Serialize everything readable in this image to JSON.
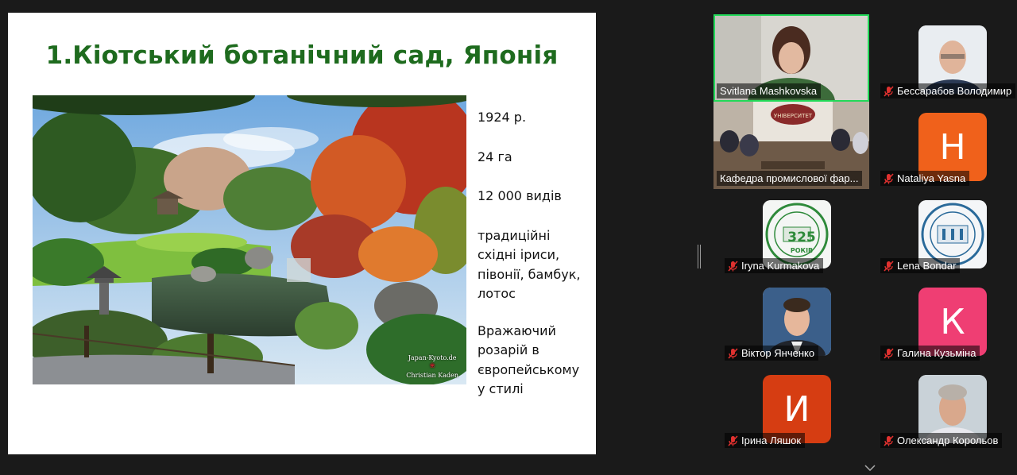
{
  "slide": {
    "title": "1.Кіотський ботанічний сад, Японія",
    "facts": {
      "year": "1924 р.",
      "area": "24 га",
      "species": "12 000 видів",
      "flowers": "традиційні східні іриси, півонії, бамбук, лотос",
      "rose_garden": "Вражаючий розарій в європейському у стилі"
    },
    "photo_credit_line1": "Japan-Kyoto.de",
    "photo_credit_line2": "Christian Kaden"
  },
  "gallery": {
    "participants": [
      {
        "name": "Svitlana Mashkovska",
        "muted": false,
        "active": true,
        "kind": "video"
      },
      {
        "name": "Бессарабов Володимир",
        "muted": true,
        "active": false,
        "kind": "photo"
      },
      {
        "name": "Кафедра промислової фар...",
        "muted": false,
        "active": false,
        "kind": "video",
        "sign_text": "УНІВЕРСИТЕТ"
      },
      {
        "name": "Nataliya Yasna",
        "muted": true,
        "active": false,
        "kind": "initial",
        "initial": "Н"
      },
      {
        "name": "Iryna Kurmakova",
        "muted": true,
        "active": false,
        "kind": "logo",
        "logo_text": "325",
        "logo_sub": "РОКІВ"
      },
      {
        "name": "Lena Bondar",
        "muted": true,
        "active": false,
        "kind": "logo"
      },
      {
        "name": "Віктор Янченко",
        "muted": true,
        "active": false,
        "kind": "photo"
      },
      {
        "name": "Галина Кузьміна",
        "muted": true,
        "active": false,
        "kind": "initial",
        "initial": "К"
      },
      {
        "name": "Ірина Ляшок",
        "muted": true,
        "active": false,
        "kind": "initial",
        "initial": "И"
      },
      {
        "name": "Олександр Корольов",
        "muted": true,
        "active": false,
        "kind": "photo"
      }
    ]
  },
  "colors": {
    "title_green": "#1e6b1e",
    "active_speaker": "#23d959",
    "muted_red": "#e0312f",
    "avatar_orange": "#f0611b",
    "avatar_pink": "#ef3e73",
    "avatar_red": "#d63d12"
  },
  "icons": {
    "muted": "mic-muted-icon",
    "resize": "resize-handle-icon",
    "scroll": "chevron-down-icon"
  }
}
